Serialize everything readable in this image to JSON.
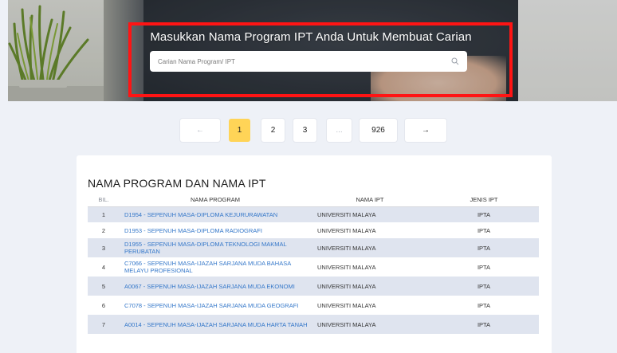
{
  "hero": {
    "title": "Masukkan Nama Program IPT Anda Untuk Membuat Carian",
    "search_placeholder": "Carian Nama Program/ IPT",
    "search_icon": "search-icon",
    "highlight_color": "#ff1414"
  },
  "pagination": {
    "prev": "←",
    "pages": [
      "1",
      "2",
      "3",
      "...",
      "926"
    ],
    "next": "→",
    "active_page": "1",
    "active_color": "#ffd457"
  },
  "table": {
    "title": "NAMA PROGRAM DAN NAMA IPT",
    "headers": {
      "bil": "BIL.",
      "program": "NAMA PROGRAM",
      "ipt": "NAMA IPT",
      "jenis": "JENIS IPT"
    },
    "link_color": "#3477c9",
    "rows": [
      {
        "bil": "1",
        "program": "D1954 - SEPENUH MASA-DIPLOMA KEJURURAWATAN",
        "ipt": "UNIVERSITI MALAYA",
        "jenis": "IPTA"
      },
      {
        "bil": "2",
        "program": "D1953 - SEPENUH MASA-DIPLOMA RADIOGRAFI",
        "ipt": "UNIVERSITI MALAYA",
        "jenis": "IPTA"
      },
      {
        "bil": "3",
        "program": "D1955 - SEPENUH MASA-DIPLOMA TEKNOLOGI MAKMAL PERUBATAN",
        "ipt": "UNIVERSITI MALAYA",
        "jenis": "IPTA"
      },
      {
        "bil": "4",
        "program": "C7066 - SEPENUH MASA-IJAZAH SARJANA MUDA BAHASA MELAYU PROFESIONAL",
        "ipt": "UNIVERSITI MALAYA",
        "jenis": "IPTA"
      },
      {
        "bil": "5",
        "program": "A0067 - SEPENUH MASA-IJAZAH SARJANA MUDA EKONOMI",
        "ipt": "UNIVERSITI MALAYA",
        "jenis": "IPTA"
      },
      {
        "bil": "6",
        "program": "C7078 - SEPENUH MASA-IJAZAH SARJANA MUDA GEOGRAFI",
        "ipt": "UNIVERSITI MALAYA",
        "jenis": "IPTA"
      },
      {
        "bil": "7",
        "program": "A0014 - SEPENUH MASA-IJAZAH SARJANA MUDA HARTA TANAH",
        "ipt": "UNIVERSITI MALAYA",
        "jenis": "IPTA"
      }
    ]
  }
}
